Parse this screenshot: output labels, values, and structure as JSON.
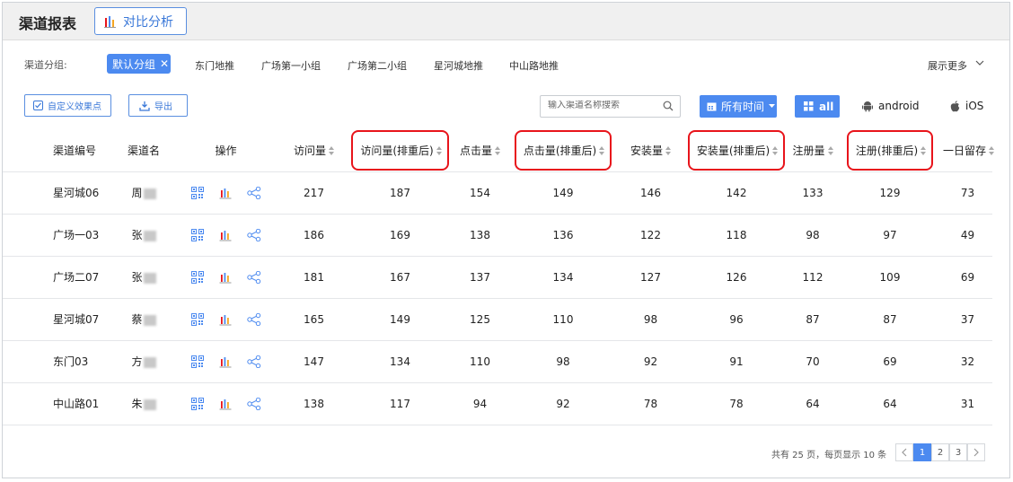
{
  "header": {
    "title": "渠道报表",
    "compare_label": "对比分析"
  },
  "groups": {
    "label": "渠道分组:",
    "active": "默认分组",
    "items": [
      "东门地推",
      "广场第一小组",
      "广场第二小组",
      "星河城地推",
      "中山路地推"
    ],
    "show_more": "展示更多"
  },
  "toolbar": {
    "custom_label": "自定义效果点",
    "export_label": "导出",
    "search_placeholder": "输入渠道名称搜索",
    "time_label": "所有时间",
    "all_label": "all",
    "android_label": "android",
    "ios_label": "iOS"
  },
  "table": {
    "columns": [
      "渠道编号",
      "渠道名",
      "操作",
      "访问量",
      "访问量(排重后)",
      "点击量",
      "点击量(排重后)",
      "安装量",
      "安装量(排重后)",
      "注册量",
      "注册(排重后)",
      "一日留存"
    ],
    "rows": [
      {
        "code": "星河城06",
        "name": "周",
        "values": [
          "217",
          "187",
          "154",
          "149",
          "146",
          "142",
          "133",
          "129",
          "73"
        ]
      },
      {
        "code": "广场一03",
        "name": "张",
        "values": [
          "186",
          "169",
          "138",
          "136",
          "122",
          "118",
          "98",
          "97",
          "49"
        ]
      },
      {
        "code": "广场二07",
        "name": "张",
        "values": [
          "181",
          "167",
          "137",
          "134",
          "127",
          "126",
          "112",
          "109",
          "69"
        ]
      },
      {
        "code": "星河城07",
        "name": "蔡",
        "values": [
          "165",
          "149",
          "125",
          "110",
          "98",
          "96",
          "87",
          "87",
          "37"
        ]
      },
      {
        "code": "东门03",
        "name": "方",
        "values": [
          "147",
          "134",
          "110",
          "98",
          "92",
          "91",
          "70",
          "69",
          "32"
        ]
      },
      {
        "code": "中山路01",
        "name": "朱",
        "values": [
          "138",
          "117",
          "94",
          "92",
          "78",
          "78",
          "64",
          "64",
          "31"
        ]
      }
    ]
  },
  "pagination": {
    "summary": "共有 25 页，每页显示 10 条",
    "pages": [
      "1",
      "2",
      "3"
    ],
    "current": "1"
  },
  "colors": {
    "accent": "#4c8af0",
    "highlight": "#e8141b"
  }
}
